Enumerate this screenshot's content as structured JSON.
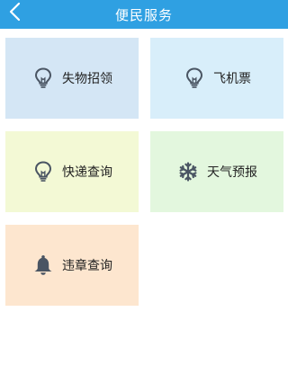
{
  "header": {
    "title": "便民服务",
    "back_icon": "chevron-left-icon"
  },
  "colors": {
    "header_bg": "#2fa0e2",
    "icon": "#4a5563"
  },
  "services": [
    {
      "label": "失物招领",
      "icon": "lightbulb-icon",
      "bg": "#d4e6f5"
    },
    {
      "label": "飞机票",
      "icon": "lightbulb-icon",
      "bg": "#d8eefa"
    },
    {
      "label": "快递查询",
      "icon": "lightbulb-icon",
      "bg": "#f3f9d5"
    },
    {
      "label": "天气预报",
      "icon": "snowflake-icon",
      "bg": "#e3f7de"
    },
    {
      "label": "违章查询",
      "icon": "bell-icon",
      "bg": "#fde6cf"
    }
  ]
}
